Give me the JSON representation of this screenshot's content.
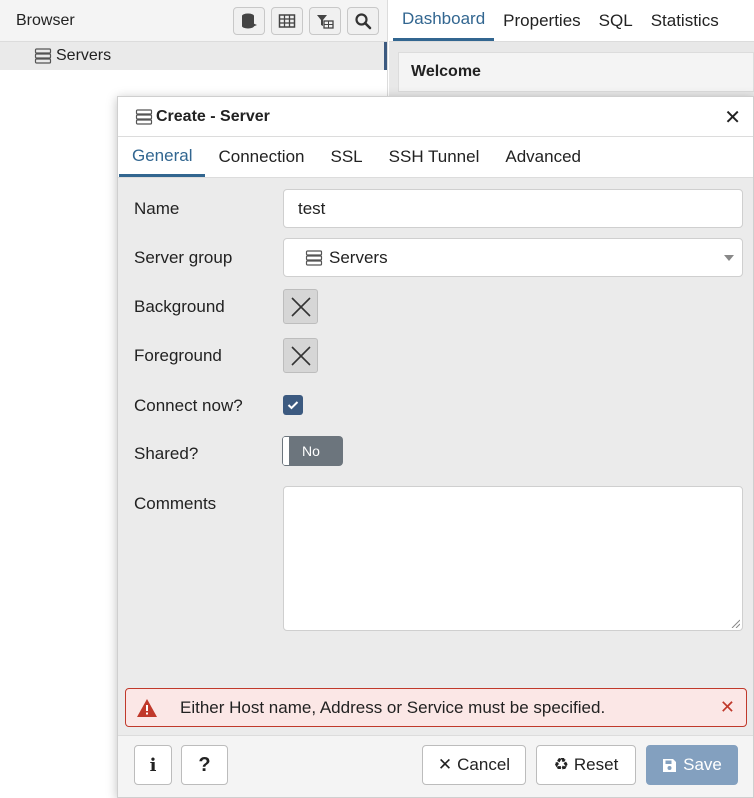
{
  "browser": {
    "title": "Browser",
    "toolbar": [
      "database-icon",
      "table-icon",
      "filter-table-icon",
      "search-icon"
    ],
    "tree_item": "Servers"
  },
  "main_tabs": [
    {
      "label": "Dashboard",
      "active": true
    },
    {
      "label": "Properties",
      "active": false
    },
    {
      "label": "SQL",
      "active": false
    },
    {
      "label": "Statistics",
      "active": false
    }
  ],
  "welcome": "Welcome",
  "dialog": {
    "title": "Create - Server",
    "tabs": [
      {
        "label": "General",
        "active": true
      },
      {
        "label": "Connection",
        "active": false
      },
      {
        "label": "SSL",
        "active": false
      },
      {
        "label": "SSH Tunnel",
        "active": false
      },
      {
        "label": "Advanced",
        "active": false
      }
    ],
    "fields": {
      "name_label": "Name",
      "name_value": "test",
      "server_group_label": "Server group",
      "server_group_value": "Servers",
      "background_label": "Background",
      "foreground_label": "Foreground",
      "connect_now_label": "Connect now?",
      "connect_now_checked": true,
      "shared_label": "Shared?",
      "shared_value": "No",
      "comments_label": "Comments",
      "comments_value": ""
    },
    "error": "Either Host name, Address or Service must be specified.",
    "buttons": {
      "info": "i",
      "help": "?",
      "cancel": "Cancel",
      "reset": "Reset",
      "save": "Save"
    }
  },
  "colors": {
    "accent": "#326690",
    "error_border": "#c0392b",
    "error_bg": "#fbe7e6",
    "save_disabled": "#83a0bf",
    "toggle_off": "#6c757d"
  }
}
